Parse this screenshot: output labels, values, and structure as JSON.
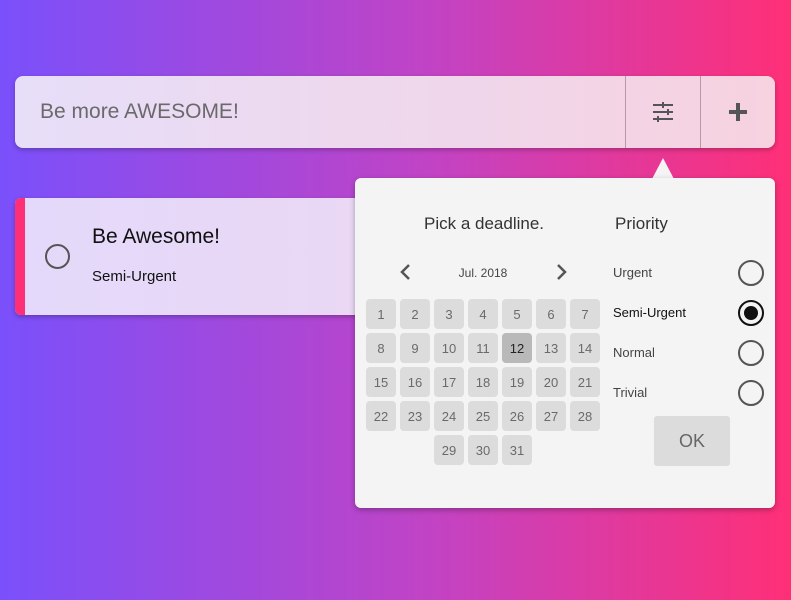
{
  "new_task": {
    "placeholder": "Be more AWESOME!"
  },
  "toolbar": {
    "filter_icon": "sliders-icon",
    "add_icon": "plus-icon"
  },
  "todo": {
    "title": "Be Awesome!",
    "priority": "Semi-Urgent",
    "accent_color": "#ff2f77"
  },
  "deadline": {
    "title": "Pick a deadline.",
    "month": "Jul. 2018",
    "selected_day": 12,
    "days": [
      "1",
      "2",
      "3",
      "4",
      "5",
      "6",
      "7",
      "8",
      "9",
      "10",
      "11",
      "12",
      "13",
      "14",
      "15",
      "16",
      "17",
      "18",
      "19",
      "20",
      "21",
      "22",
      "23",
      "24",
      "25",
      "26",
      "27",
      "28",
      "29",
      "30",
      "31"
    ]
  },
  "priority": {
    "title": "Priority",
    "options": [
      "Urgent",
      "Semi-Urgent",
      "Normal",
      "Trivial"
    ],
    "selected": "Semi-Urgent"
  },
  "ok_label": "OK"
}
